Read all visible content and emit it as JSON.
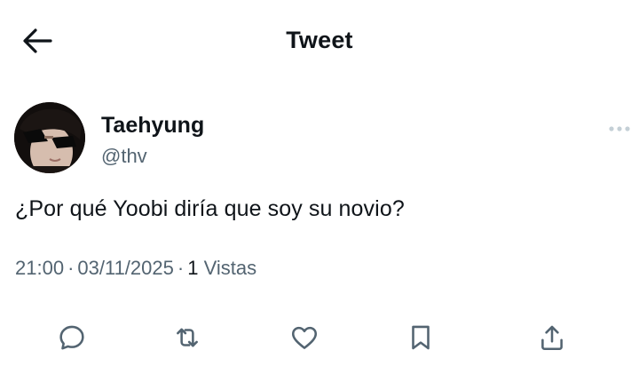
{
  "header": {
    "title": "Tweet",
    "back_icon": "arrow-left-icon"
  },
  "author": {
    "display_name": "Taehyung",
    "handle": "@thv",
    "avatar_icon": "avatar",
    "more_icon": "more-horizontal-icon"
  },
  "tweet": {
    "text": "¿Por qué Yoobi diría que soy su novio?"
  },
  "meta": {
    "time": "21:00",
    "separator": "·",
    "date": "03/11/2025",
    "views_count": "1",
    "views_label": "Vistas"
  },
  "actions": [
    {
      "name": "reply",
      "icon": "reply-icon"
    },
    {
      "name": "retweet",
      "icon": "retweet-icon"
    },
    {
      "name": "like",
      "icon": "heart-icon"
    },
    {
      "name": "bookmark",
      "icon": "bookmark-icon"
    },
    {
      "name": "share",
      "icon": "share-icon"
    }
  ],
  "colors": {
    "text_primary": "#0f1419",
    "text_secondary": "#536471",
    "icon": "#536471",
    "background": "#ffffff"
  }
}
